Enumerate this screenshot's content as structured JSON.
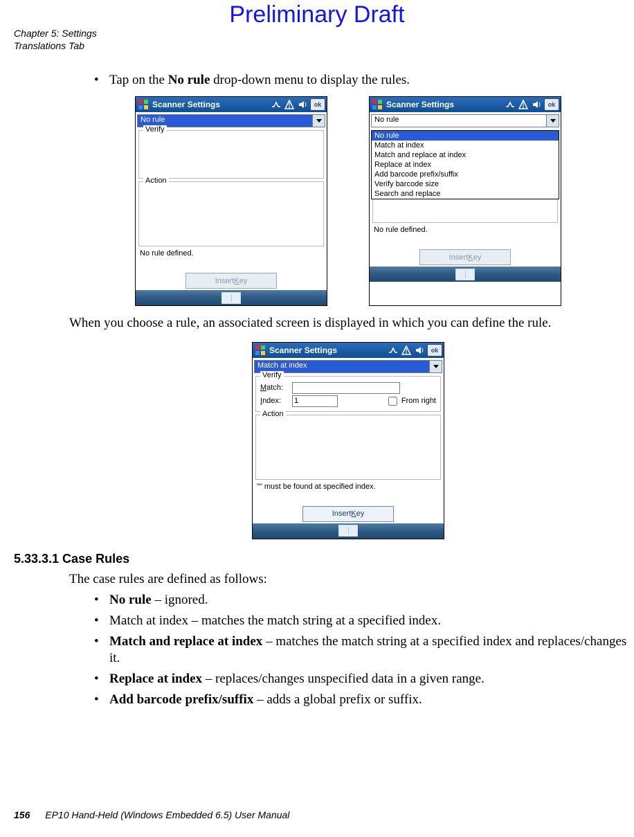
{
  "watermark": "Preliminary Draft",
  "header": {
    "line1": "Chapter 5: Settings",
    "line2": "Translations Tab"
  },
  "text": {
    "tap_no_rule_pre": "Tap on the ",
    "tap_no_rule_bold": "No rule",
    "tap_no_rule_post": " drop-down menu to display the rules.",
    "when_choose": "When you choose a rule, an associated screen is displayed in which you can define the rule.",
    "section_heading": "5.33.3.1 Case Rules",
    "case_intro": "The case rules are defined as follows:"
  },
  "rules": {
    "no_rule_b": "No rule",
    "no_rule_t": " – ignored.",
    "match_idx": "Match at index – matches the match string at a specified index.",
    "mri_b": "Match and replace at index",
    "mri_t": " – matches the match string at a specified index and replaces/changes it.",
    "rai_b": "Replace at index",
    "rai_t": " – replaces/changes unspecified data in a given range.",
    "abp_b": "Add barcode prefix/suffix",
    "abp_t": " – adds a global prefix or suffix."
  },
  "device": {
    "title": "Scanner Settings",
    "ok": "ok",
    "dropdown_norule": "No rule",
    "dropdown_match": "Match at index",
    "dropdown_options": [
      "No rule",
      "Match at index",
      "Match and replace at index",
      "Replace at index",
      "Add barcode prefix/suffix",
      "Verify barcode size",
      "Search and replace"
    ],
    "group_verify": "Verify",
    "group_action": "Action",
    "status_norule": "No rule defined.",
    "status_match": "\"\" must be found at specified index.",
    "insert_key_pre": "Insert ",
    "insert_key_u": "K",
    "insert_key_post": "ey",
    "match_label_pre": "",
    "match_label_u": "M",
    "match_label_post": "atch:",
    "index_label_pre": "",
    "index_label_u": "I",
    "index_label_post": "ndex:",
    "index_value": "1",
    "from_right": "From right"
  },
  "footer": {
    "page": "156",
    "manual": "EP10 Hand-Held (Windows Embedded 6.5) User Manual"
  }
}
